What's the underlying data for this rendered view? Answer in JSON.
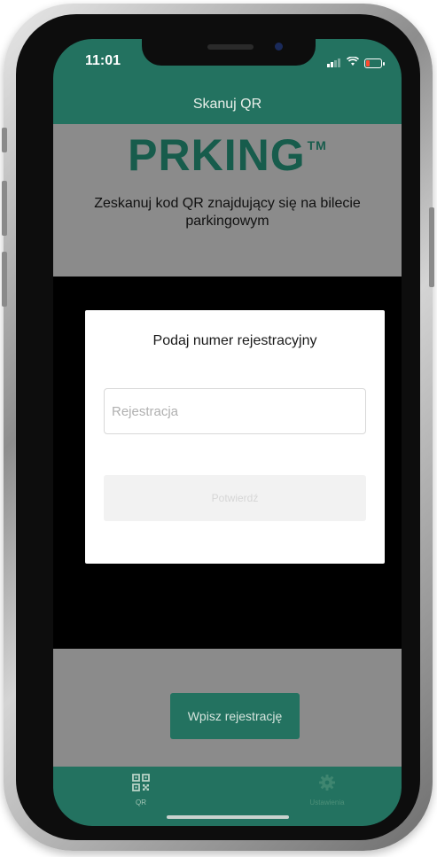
{
  "status_bar": {
    "time": "11:01",
    "icons": [
      "signal-icon",
      "wifi-icon",
      "battery-low-icon"
    ]
  },
  "nav": {
    "title": "Skanuj QR"
  },
  "brand": {
    "logo": "PRKING",
    "trademark": "TM"
  },
  "scan": {
    "instruction": "Zeskanuj kod QR znajdujący się na bilecie parkingowym"
  },
  "modal": {
    "title": "Podaj numer rejestracyjny",
    "plate_input": {
      "placeholder": "Rejestracja",
      "value": ""
    },
    "confirm_label": "Potwierdź"
  },
  "main": {
    "enter_plate_label": "Wpisz rejestrację"
  },
  "tabs": [
    {
      "label": "QR",
      "icon": "qr-code-icon",
      "active": true
    },
    {
      "label": "Ustawienia",
      "icon": "gear-icon",
      "active": false
    }
  ],
  "colors": {
    "brand_green": "#237260",
    "logo_green": "#175c4c",
    "overlay_gray": "#8b8b8b",
    "battery_red": "#ff4a2f"
  }
}
